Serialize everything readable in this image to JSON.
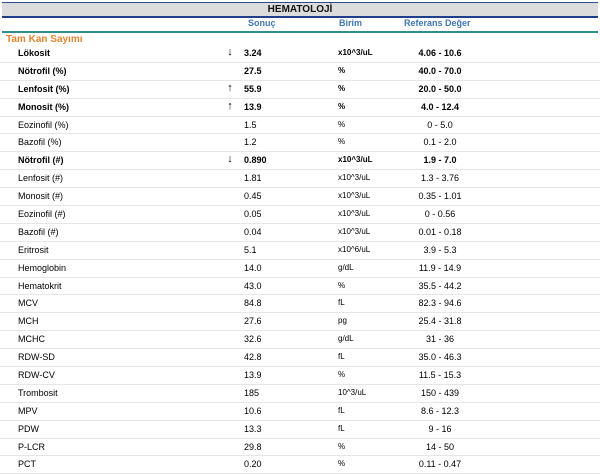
{
  "header": {
    "title": "HEMATOLOJİ"
  },
  "columns": {
    "result": "Sonuç",
    "unit": "Birim",
    "reference": "Referans Değer"
  },
  "section": {
    "title": "Tam Kan Sayımı"
  },
  "rows": [
    {
      "name": "Lökosit",
      "flag": "↓",
      "value": "3.24",
      "unit": "x10^3/uL",
      "reference": "4.06 - 10.6",
      "bold": true
    },
    {
      "name": "Nötrofil (%)",
      "flag": "",
      "value": "27.5",
      "unit": "%",
      "reference": "40.0 - 70.0",
      "bold": true
    },
    {
      "name": "Lenfosit (%)",
      "flag": "↑",
      "value": "55.9",
      "unit": "%",
      "reference": "20.0 - 50.0",
      "bold": true
    },
    {
      "name": "Monosit (%)",
      "flag": "↑",
      "value": "13.9",
      "unit": "%",
      "reference": "4.0 - 12.4",
      "bold": true
    },
    {
      "name": "Eozinofil (%)",
      "flag": "",
      "value": "1.5",
      "unit": "%",
      "reference": "0 - 5.0",
      "bold": false
    },
    {
      "name": "Bazofil (%)",
      "flag": "",
      "value": "1.2",
      "unit": "%",
      "reference": "0.1 - 2.0",
      "bold": false
    },
    {
      "name": "Nötrofil (#)",
      "flag": "↓",
      "value": "0.890",
      "unit": "x10^3/uL",
      "reference": "1.9 - 7.0",
      "bold": true
    },
    {
      "name": "Lenfosit (#)",
      "flag": "",
      "value": "1.81",
      "unit": "x10^3/uL",
      "reference": "1.3 - 3.76",
      "bold": false
    },
    {
      "name": "Monosit (#)",
      "flag": "",
      "value": "0.45",
      "unit": "x10^3/uL",
      "reference": "0.35 - 1.01",
      "bold": false
    },
    {
      "name": "Eozinofil (#)",
      "flag": "",
      "value": "0.05",
      "unit": "x10^3/uL",
      "reference": "0 - 0.56",
      "bold": false
    },
    {
      "name": "Bazofil (#)",
      "flag": "",
      "value": "0.04",
      "unit": "x10^3/uL",
      "reference": "0.01 - 0.18",
      "bold": false
    },
    {
      "name": "Eritrosit",
      "flag": "",
      "value": "5.1",
      "unit": "x10^6/uL",
      "reference": "3.9 - 5.3",
      "bold": false
    },
    {
      "name": "Hemoglobin",
      "flag": "",
      "value": "14.0",
      "unit": "g/dL",
      "reference": "11.9 - 14.9",
      "bold": false
    },
    {
      "name": "Hematokrit",
      "flag": "",
      "value": "43.0",
      "unit": "%",
      "reference": "35.5 - 44.2",
      "bold": false
    },
    {
      "name": "MCV",
      "flag": "",
      "value": "84.8",
      "unit": "fL",
      "reference": "82.3 - 94.6",
      "bold": false
    },
    {
      "name": "MCH",
      "flag": "",
      "value": "27.6",
      "unit": "pg",
      "reference": "25.4 - 31.8",
      "bold": false
    },
    {
      "name": "MCHC",
      "flag": "",
      "value": "32.6",
      "unit": "g/dL",
      "reference": "31 - 36",
      "bold": false
    },
    {
      "name": "RDW-SD",
      "flag": "",
      "value": "42.8",
      "unit": "fL",
      "reference": "35.0 - 46.3",
      "bold": false
    },
    {
      "name": "RDW-CV",
      "flag": "",
      "value": "13.9",
      "unit": "%",
      "reference": "11.5 - 15.3",
      "bold": false
    },
    {
      "name": "Trombosit",
      "flag": "",
      "value": "185",
      "unit": "10^3/uL",
      "reference": "150 - 439",
      "bold": false
    },
    {
      "name": "MPV",
      "flag": "",
      "value": "10.6",
      "unit": "fL",
      "reference": "8.6 - 12.3",
      "bold": false
    },
    {
      "name": "PDW",
      "flag": "",
      "value": "13.3",
      "unit": "fL",
      "reference": "9 - 16",
      "bold": false
    },
    {
      "name": "P-LCR",
      "flag": "",
      "value": "29.8",
      "unit": "%",
      "reference": "14 - 50",
      "bold": false
    },
    {
      "name": "PCT",
      "flag": "",
      "value": "0.20",
      "unit": "%",
      "reference": "0.11 - 0.47",
      "bold": false
    }
  ]
}
